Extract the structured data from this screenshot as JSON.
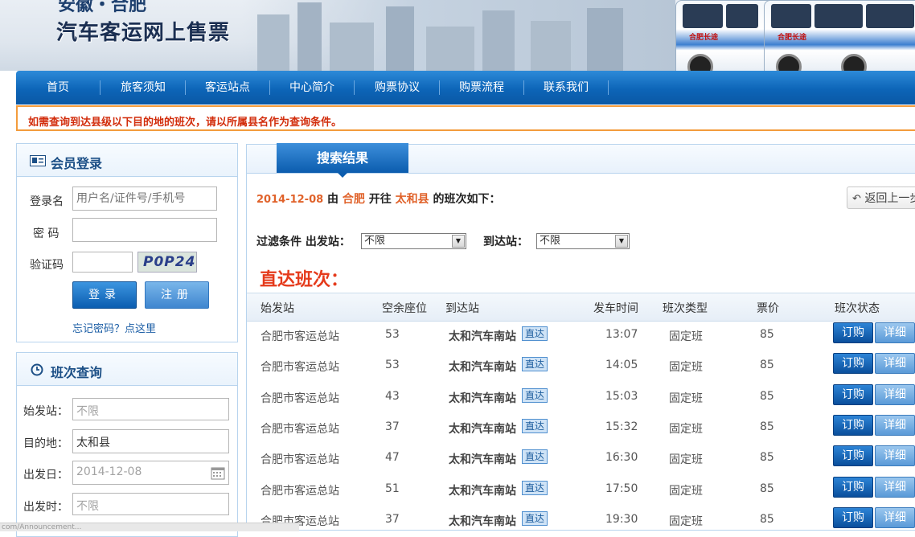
{
  "site": {
    "title_top": "安徽・合肥",
    "title": "汽车客运网上售票",
    "bus_sign": "合肥长途"
  },
  "nav": [
    "首页",
    "旅客须知",
    "客运站点",
    "中心简介",
    "购票协议",
    "购票流程",
    "联系我们"
  ],
  "notice": "如需查询到达县级以下目的地的班次，请以所属县名作为查询条件。",
  "login": {
    "title": "会员登录",
    "username_label": "登录名",
    "username_placeholder": "用户名/证件号/手机号",
    "password_label": "密 码",
    "captcha_label": "验证码",
    "captcha_text": "P0P24",
    "login_button": "登录",
    "register_button": "注册",
    "forgot": "忘记密码？点这里"
  },
  "search": {
    "title": "班次查询",
    "from_label": "始发站：",
    "from_value": "不限",
    "to_label": "目的地：",
    "to_value": "太和县",
    "date_label": "出发日：",
    "date_value": "2014-12-08",
    "time_label": "出发时：",
    "time_value": "不限"
  },
  "results": {
    "tab": "搜索结果",
    "date": "2014-12-08",
    "from_word": "由",
    "origin": "合肥",
    "to_word": "开往",
    "destination": "太和县",
    "suffix": "的班次如下：",
    "back": "返回上一步",
    "filter_label": "过滤条件",
    "depart_label": "出发站：",
    "depart_value": "不限",
    "arrive_label": "到达站：",
    "arrive_value": "不限",
    "direct_title": "直达班次：",
    "headers": [
      "始发站",
      "空余座位",
      "到达站",
      "发车时间",
      "班次类型",
      "票价",
      "班次状态"
    ],
    "direct_tag": "直达",
    "order_label": "订购",
    "detail_label": "详细",
    "rows": [
      {
        "origin": "合肥市客运总站",
        "seats": "53",
        "dest": "太和汽车南站",
        "time": "13:07",
        "type": "固定班",
        "price": "85"
      },
      {
        "origin": "合肥市客运总站",
        "seats": "53",
        "dest": "太和汽车南站",
        "time": "14:05",
        "type": "固定班",
        "price": "85"
      },
      {
        "origin": "合肥市客运总站",
        "seats": "43",
        "dest": "太和汽车南站",
        "time": "15:03",
        "type": "固定班",
        "price": "85"
      },
      {
        "origin": "合肥市客运总站",
        "seats": "37",
        "dest": "太和汽车南站",
        "time": "15:32",
        "type": "固定班",
        "price": "85"
      },
      {
        "origin": "合肥市客运总站",
        "seats": "47",
        "dest": "太和汽车南站",
        "time": "16:30",
        "type": "固定班",
        "price": "85"
      },
      {
        "origin": "合肥市客运总站",
        "seats": "51",
        "dest": "太和汽车南站",
        "time": "17:50",
        "type": "固定班",
        "price": "85"
      },
      {
        "origin": "合肥市客运总站",
        "seats": "37",
        "dest": "太和汽车南站",
        "time": "19:30",
        "type": "固定班",
        "price": "85"
      }
    ]
  },
  "statusbar": "com/Announcement..."
}
